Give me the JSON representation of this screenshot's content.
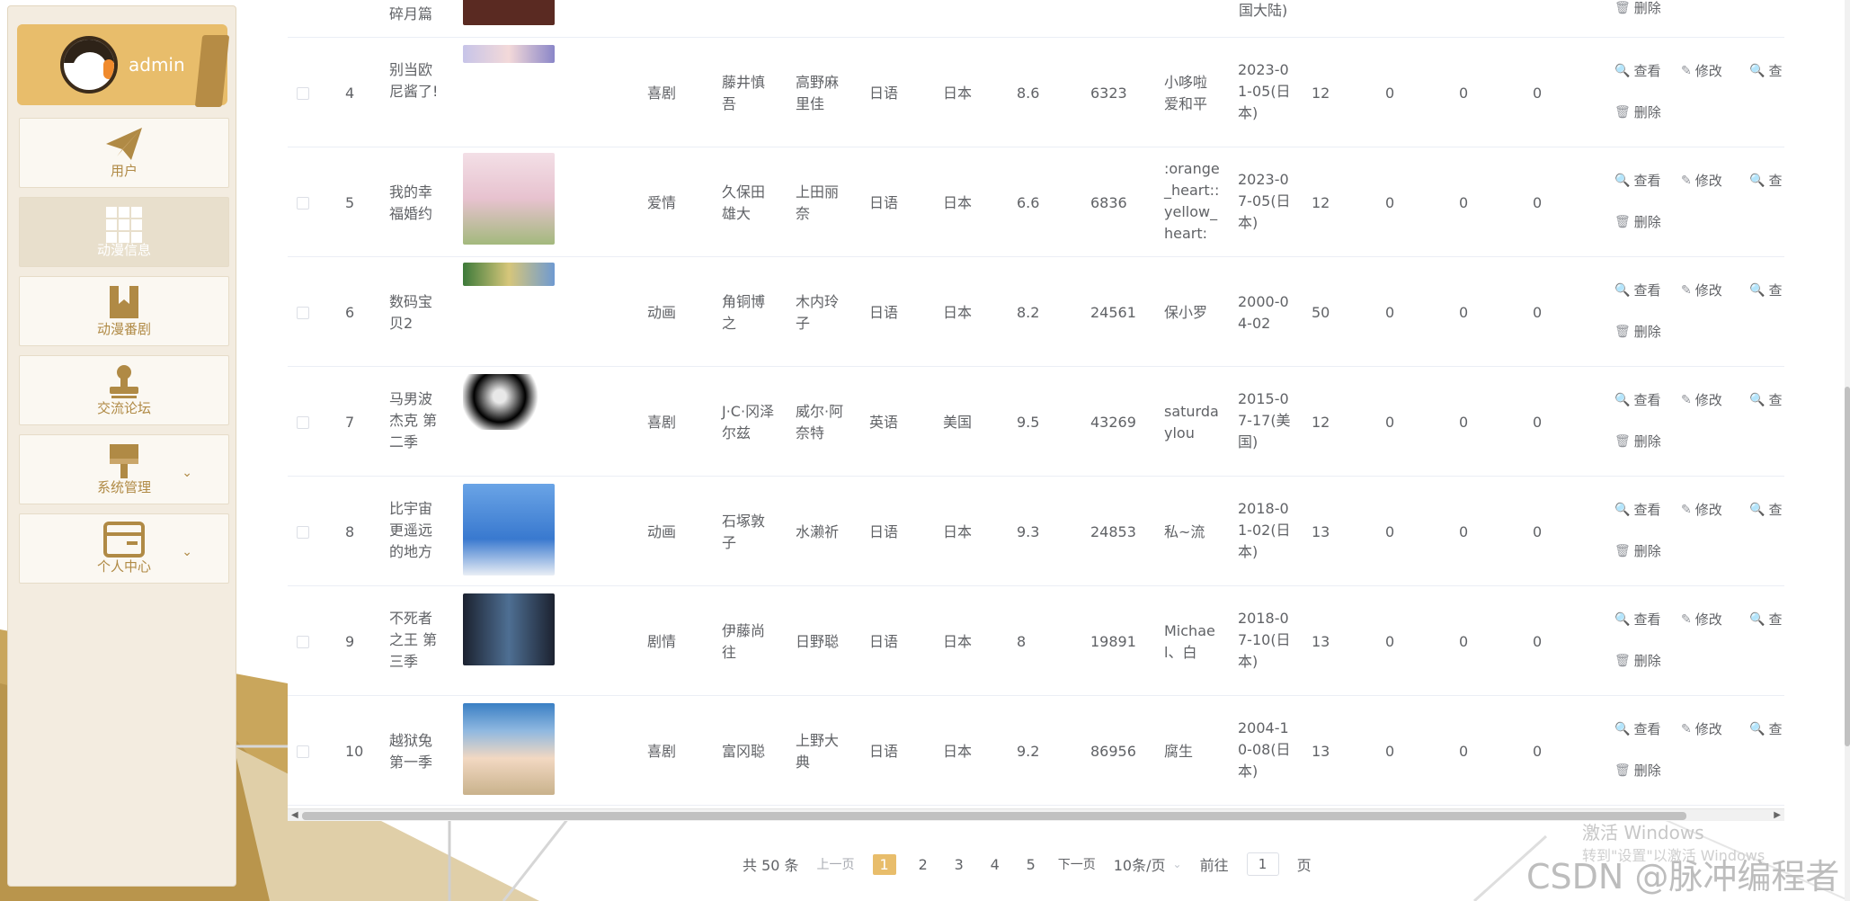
{
  "sidebar": {
    "user_name": "admin",
    "items": [
      {
        "label": "用户"
      },
      {
        "label": "动漫信息"
      },
      {
        "label": "动漫番剧"
      },
      {
        "label": "交流论坛"
      },
      {
        "label": "系统管理"
      },
      {
        "label": "个人中心"
      }
    ]
  },
  "table": {
    "partial_top_row": {
      "title": "碎月篇",
      "region": "国大陆)",
      "delete_label": "删除"
    },
    "rows": [
      {
        "idx": "4",
        "title": "别当欧尼酱了!",
        "genre": "喜剧",
        "director": "藤井慎吾",
        "cast": "高野麻里佳",
        "language": "日语",
        "region": "日本",
        "score": "8.6",
        "views": "6323",
        "uploader": "小哆啦爱和平",
        "date": "2023-01-05(日本)",
        "episodes": "12",
        "c1": "0",
        "c2": "0",
        "c3": "0"
      },
      {
        "idx": "5",
        "title": "我的幸福婚约",
        "genre": "爱情",
        "director": "久保田雄大",
        "cast": "上田丽奈",
        "language": "日语",
        "region": "日本",
        "score": "6.6",
        "views": "6836",
        "uploader": ":orange_heart::yellow_heart:",
        "date": "2023-07-05(日本)",
        "episodes": "12",
        "c1": "0",
        "c2": "0",
        "c3": "0"
      },
      {
        "idx": "6",
        "title": "数码宝贝2",
        "genre": "动画",
        "director": "角铜博之",
        "cast": "木内玲子",
        "language": "日语",
        "region": "日本",
        "score": "8.2",
        "views": "24561",
        "uploader": "保小罗",
        "date": "2000-04-02",
        "episodes": "50",
        "c1": "0",
        "c2": "0",
        "c3": "0"
      },
      {
        "idx": "7",
        "title": "马男波杰克 第二季",
        "genre": "喜剧",
        "director": "J·C·冈泽尔兹",
        "cast": "威尔·阿奈特",
        "language": "英语",
        "region": "美国",
        "score": "9.5",
        "views": "43269",
        "uploader": "saturdaylou",
        "date": "2015-07-17(美国)",
        "episodes": "12",
        "c1": "0",
        "c2": "0",
        "c3": "0"
      },
      {
        "idx": "8",
        "title": "比宇宙更遥远的地方",
        "genre": "动画",
        "director": "石塚敦子",
        "cast": "水濑祈",
        "language": "日语",
        "region": "日本",
        "score": "9.3",
        "views": "24853",
        "uploader": "私~流",
        "date": "2018-01-02(日本)",
        "episodes": "13",
        "c1": "0",
        "c2": "0",
        "c3": "0"
      },
      {
        "idx": "9",
        "title": "不死者之王 第三季",
        "genre": "剧情",
        "director": "伊藤尚往",
        "cast": "日野聪",
        "language": "日语",
        "region": "日本",
        "score": "8",
        "views": "19891",
        "uploader": "Michael、白",
        "date": "2018-07-10(日本)",
        "episodes": "13",
        "c1": "0",
        "c2": "0",
        "c3": "0"
      },
      {
        "idx": "10",
        "title": "越狱兔第一季",
        "genre": "喜剧",
        "director": "富冈聪",
        "cast": "上野大典",
        "language": "日语",
        "region": "日本",
        "score": "9.2",
        "views": "86956",
        "uploader": "腐生",
        "date": "2004-10-08(日本)",
        "episodes": "13",
        "c1": "0",
        "c2": "0",
        "c3": "0"
      }
    ],
    "actions": {
      "view": "查看",
      "edit": "修改",
      "view_extra": "查",
      "delete": "删除"
    }
  },
  "pagination": {
    "total": "共 50 条",
    "prev": "上一页",
    "pages": [
      "1",
      "2",
      "3",
      "4",
      "5"
    ],
    "current": "1",
    "next": "下一页",
    "page_size": "10条/页",
    "goto_prefix": "前往",
    "goto_value": "1",
    "goto_suffix": "页"
  },
  "watermarks": {
    "activate_title": "激活 Windows",
    "activate_sub": "转到\"设置\"以激活 Windows",
    "csdn": "CSDN @脉冲编程者"
  },
  "colors": {
    "accent": "#e8bd6b",
    "sidebar_bg": "#f3ece0",
    "menu_text": "#b08a45"
  }
}
